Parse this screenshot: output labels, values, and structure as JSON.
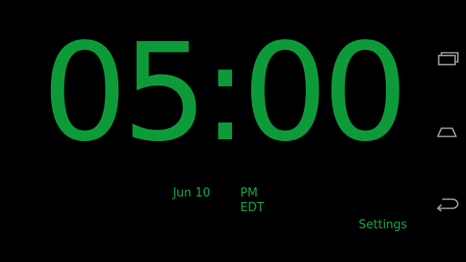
{
  "clock": {
    "time": "05:00",
    "date": "Jun 10",
    "ampm": "PM",
    "timezone": "EDT"
  },
  "settings_label": "Settings",
  "colors": {
    "background": "#000000",
    "clock_green": "#0d9b3a",
    "text_green": "#14a544",
    "nav_icon": "#9a9a9a"
  },
  "navbar": {
    "buttons": [
      {
        "icon": "recent-apps-icon"
      },
      {
        "icon": "home-icon"
      },
      {
        "icon": "back-icon"
      }
    ]
  }
}
